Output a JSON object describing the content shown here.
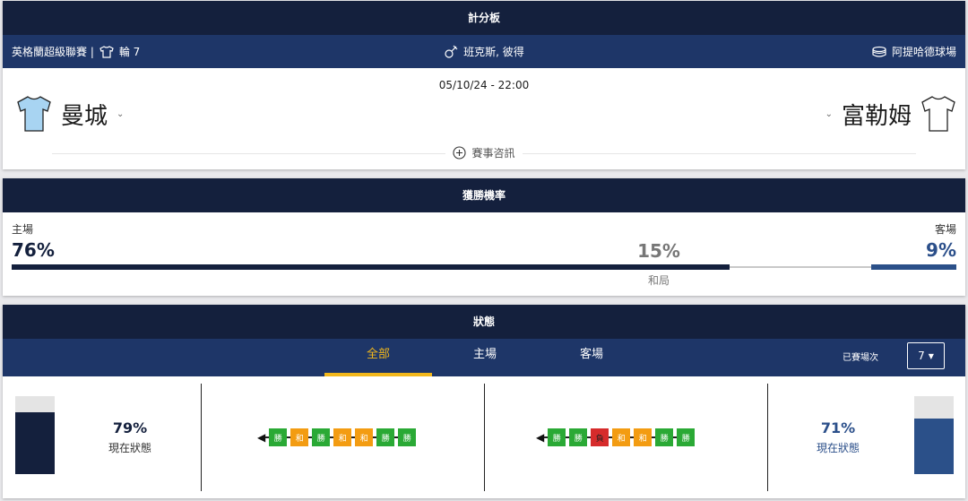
{
  "scoreboard": {
    "title": "計分板",
    "competition": "英格蘭超級聯賽 |",
    "round": "輪 7",
    "referee": "班克斯, 彼得",
    "venue": "阿提哈德球場",
    "datetime": "05/10/24 - 22:00",
    "home_team": "曼城",
    "away_team": "富勒姆",
    "home_kit_color": "#a8d4f2",
    "away_kit_color": "#ffffff",
    "match_info": "賽事咨訊"
  },
  "win_prob": {
    "title": "獲勝機率",
    "home_label": "主場",
    "home_pct": "76%",
    "draw_pct": "15%",
    "draw_label": "和局",
    "away_label": "客場",
    "away_pct": "9%",
    "home_value": 76,
    "draw_value": 15,
    "away_value": 9
  },
  "form": {
    "title": "狀態",
    "tabs": [
      "全部",
      "主場",
      "客場"
    ],
    "active_tab": "全部",
    "played_label": "已賽場次",
    "played_value": "7",
    "home_pct": "79%",
    "home_label": "現在狀態",
    "home_value": 79,
    "away_pct": "71%",
    "away_label": "現在狀態",
    "away_value": 71,
    "home_results": [
      "勝",
      "和",
      "勝",
      "和",
      "和",
      "勝",
      "勝"
    ],
    "home_codes": [
      "W",
      "D",
      "W",
      "D",
      "D",
      "W",
      "W"
    ],
    "away_results": [
      "勝",
      "勝",
      "負",
      "和",
      "和",
      "勝",
      "勝"
    ],
    "away_codes": [
      "W",
      "W",
      "L",
      "D",
      "D",
      "W",
      "W"
    ]
  },
  "colors": {
    "header_bg": "#14203d",
    "subbar_bg": "#1e3668",
    "accent": "#f2b71b",
    "home_color": "#14203d",
    "away_color": "#2b5089",
    "win": "#2aa935",
    "draw": "#f39c12",
    "loss": "#d62b2b"
  }
}
